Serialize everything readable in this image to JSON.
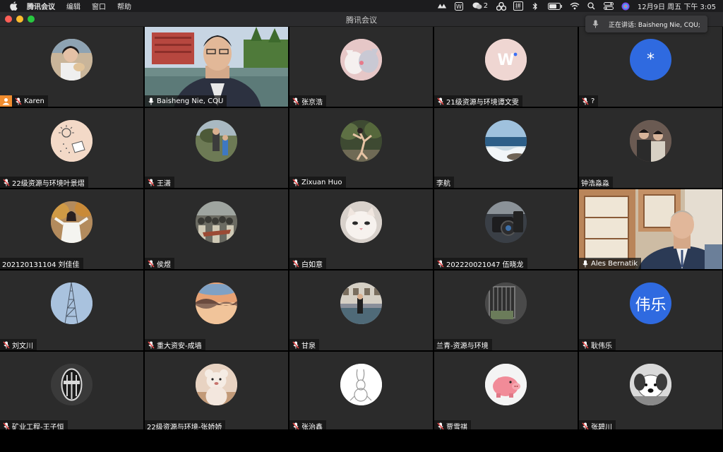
{
  "menubar": {
    "app_name": "腾讯会议",
    "items": [
      "编辑",
      "窗口",
      "帮助"
    ],
    "wechat_count": "2",
    "ime_label": "拼",
    "clock": "12月9日 周五 下午 3:05"
  },
  "window": {
    "title": "腾讯会议"
  },
  "toast": {
    "text": "正在讲话: Baisheng Nie, CQU;"
  },
  "colors": {
    "tile_bg": "#2b2b2b",
    "active_border": "#2fbf3c",
    "host_badge": "#f08c2e",
    "muted_mic": "#e84b4b"
  },
  "participants": [
    {
      "name": "Karen",
      "mic": "muted",
      "host": true,
      "avatar": "photo-person-dog",
      "bg": "#c9b59a"
    },
    {
      "name": "Baisheng Nie, CQU",
      "mic": "on",
      "video": "building-lake",
      "active": true
    },
    {
      "name": "张京浩",
      "mic": "muted",
      "avatar": "cartoon-animals",
      "bg": "#e6c7c7"
    },
    {
      "name": "21级资源与环境谭文雯",
      "mic": "muted",
      "avatar": "letter-w",
      "text": "W",
      "bg": "#efd6d2",
      "fg": "#c98a7c"
    },
    {
      "name": "?",
      "mic": "muted",
      "avatar": "asterisk",
      "text": "*",
      "bg": "#2f6ae0",
      "fg": "#ffffff"
    },
    {
      "name": "22级资源与环境叶景熠",
      "mic": "muted",
      "avatar": "doodle-sun",
      "bg": "#f3d9c7"
    },
    {
      "name": "王潇",
      "mic": "muted",
      "avatar": "photo-outdoor-people",
      "bg": "#6d7a55"
    },
    {
      "name": "Zixuan Huo",
      "mic": "muted",
      "avatar": "photo-dancer",
      "bg": "#3e4a32"
    },
    {
      "name": "李航",
      "mic": "none",
      "avatar": "photo-sea",
      "bg": "#6d93b5"
    },
    {
      "name": "钟浩淼淼",
      "mic": "none",
      "avatar": "photo-friends",
      "bg": "#6a5a52"
    },
    {
      "name": "202120131104 刘佳佳",
      "mic": "none",
      "avatar": "photo-girl-autumn",
      "bg": "#b38b5d"
    },
    {
      "name": "侯煜",
      "mic": "muted",
      "avatar": "photo-crowd",
      "bg": "#6b6b62"
    },
    {
      "name": "白如意",
      "mic": "muted",
      "avatar": "photo-cat",
      "bg": "#d8d1cb"
    },
    {
      "name": "202220021047 伍晓龙",
      "mic": "muted",
      "avatar": "photo-camera",
      "bg": "#3a3f46"
    },
    {
      "name": "Ales Bernatik",
      "mic": "on",
      "video": "office-man"
    },
    {
      "name": "刘文川",
      "mic": "muted",
      "avatar": "photo-tower",
      "bg": "#a9c2de"
    },
    {
      "name": "重大资安-成墙",
      "mic": "muted",
      "avatar": "photo-sunset",
      "bg": "#c98a62"
    },
    {
      "name": "甘泉",
      "mic": "muted",
      "avatar": "photo-canal",
      "bg": "#8a8f9a"
    },
    {
      "name": "兰青-资源与环境",
      "mic": "none",
      "avatar": "photo-window",
      "bg": "#4a4a4a"
    },
    {
      "name": "耿伟乐",
      "mic": "muted",
      "avatar": "text-name",
      "text": "伟乐",
      "bg": "#2f6ae0",
      "fg": "#ffffff"
    },
    {
      "name": "矿业工程-王子恒",
      "mic": "muted",
      "avatar": "photo-juventus",
      "bg": "#3a3a3a"
    },
    {
      "name": "22级资源与环境-张娇娇",
      "mic": "none",
      "avatar": "photo-teddy",
      "bg": "#e8d3c2"
    },
    {
      "name": "张治鑫",
      "mic": "muted",
      "avatar": "drawing-rabbit",
      "bg": "#ffffff"
    },
    {
      "name": "贾雪祺",
      "mic": "muted",
      "avatar": "pig-toy",
      "bg": "#f4f4f4"
    },
    {
      "name": "张碧川",
      "mic": "muted",
      "avatar": "photo-bw-dog",
      "bg": "#d9d9d9"
    }
  ]
}
